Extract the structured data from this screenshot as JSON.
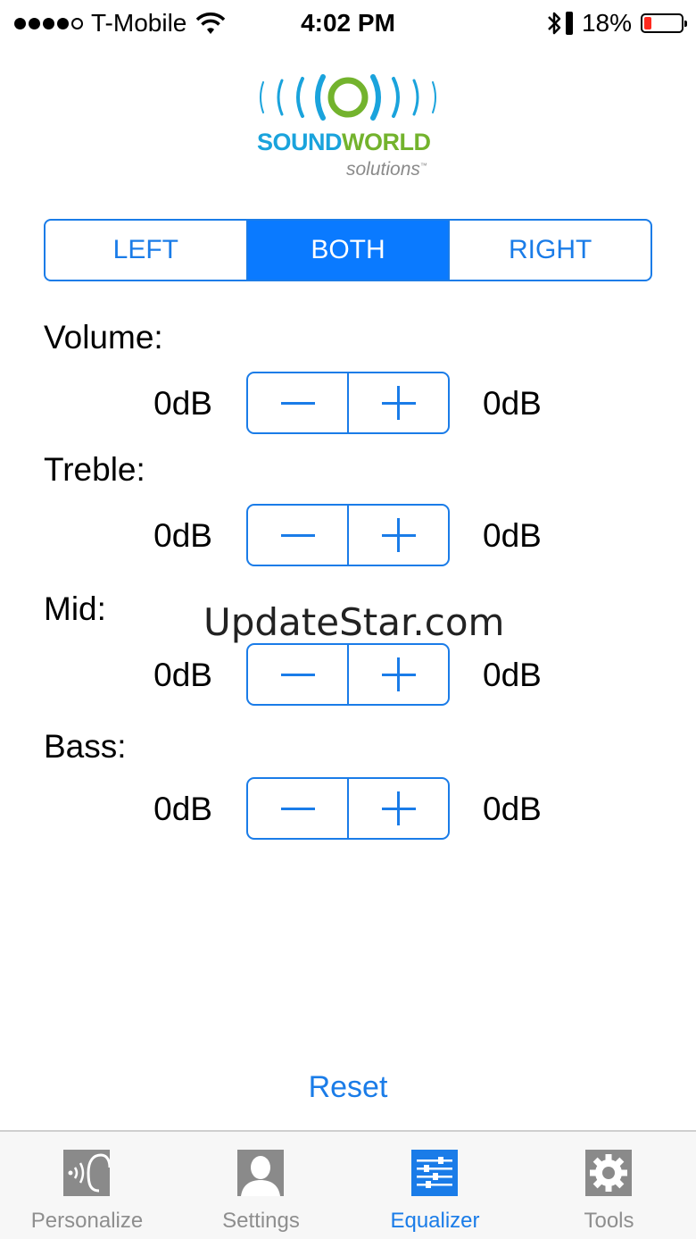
{
  "status_bar": {
    "carrier": "T-Mobile",
    "time": "4:02 PM",
    "battery_percent": "18%",
    "battery_level": 0.18,
    "signal_bars": 4
  },
  "logo": {
    "word_sound": "SOUND",
    "word_world": "WORLD",
    "subtitle": "solutions",
    "trademark": "™",
    "colors": {
      "sound": "#1aa3dc",
      "world": "#73b32d"
    }
  },
  "channel_selector": {
    "options": [
      "LEFT",
      "BOTH",
      "RIGHT"
    ],
    "selected": "BOTH"
  },
  "controls": [
    {
      "label": "Volume:",
      "left_value": "0dB",
      "right_value": "0dB"
    },
    {
      "label": "Treble:",
      "left_value": "0dB",
      "right_value": "0dB"
    },
    {
      "label": "Mid:",
      "left_value": "0dB",
      "right_value": "0dB"
    },
    {
      "label": "Bass:",
      "left_value": "0dB",
      "right_value": "0dB"
    }
  ],
  "watermark": "UpdateStar.com",
  "reset_label": "Reset",
  "tabs": [
    {
      "label": "Personalize",
      "icon": "ear-sound-icon",
      "active": false
    },
    {
      "label": "Settings",
      "icon": "person-icon",
      "active": false
    },
    {
      "label": "Equalizer",
      "icon": "equalizer-sliders-icon",
      "active": true
    },
    {
      "label": "Tools",
      "icon": "gear-icon",
      "active": false
    }
  ],
  "colors": {
    "accent": "#1a7ce8",
    "selected_fill": "#0a7aff",
    "inactive_tab": "#8e8e8e",
    "battery_low": "#ff2a1f"
  }
}
